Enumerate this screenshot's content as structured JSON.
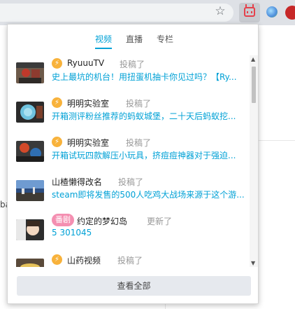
{
  "browser": {
    "toolbar_icons": [
      "star-icon",
      "bilibili-extension-icon",
      "globe-extension-icon",
      "profile-avatar"
    ]
  },
  "background": {
    "fragment_text": "ba"
  },
  "popup": {
    "tabs": [
      {
        "label": "视频",
        "active": true
      },
      {
        "label": "直播",
        "active": false
      },
      {
        "label": "专栏",
        "active": false
      }
    ],
    "items": [
      {
        "badge": "bolt",
        "author": "RyuuuTV",
        "action": "投稿了",
        "title": "史上最坑的机台！用扭蛋机抽卡你见过吗？【Ry..."
      },
      {
        "badge": "bolt",
        "author": "明明实验室",
        "action": "投稿了",
        "title": "开箱测评粉丝推荐的蚂蚁城堡，二十天后蚂蚁挖..."
      },
      {
        "badge": "bolt",
        "author": "明明实验室",
        "action": "投稿了",
        "title": "开箱试玩四款解压小玩具，挤痘痘神器对于强迫..."
      },
      {
        "badge": "none",
        "author": "山楂懒得改名",
        "action": "投稿了",
        "title": "steam即将发售的500人吃鸡大战场来源于这个游..."
      },
      {
        "badge": "tag",
        "badge_label": "番剧",
        "author": "约定的梦幻岛",
        "action": "更新了",
        "title": "5 301045"
      },
      {
        "badge": "bolt",
        "author": "山药视频",
        "action": "投稿了",
        "title": ""
      }
    ],
    "view_all_label": "查看全部"
  },
  "colors": {
    "accent": "#00a1d6",
    "bolt_badge": "#f8b23b",
    "tag_badge": "#f48fb1"
  }
}
